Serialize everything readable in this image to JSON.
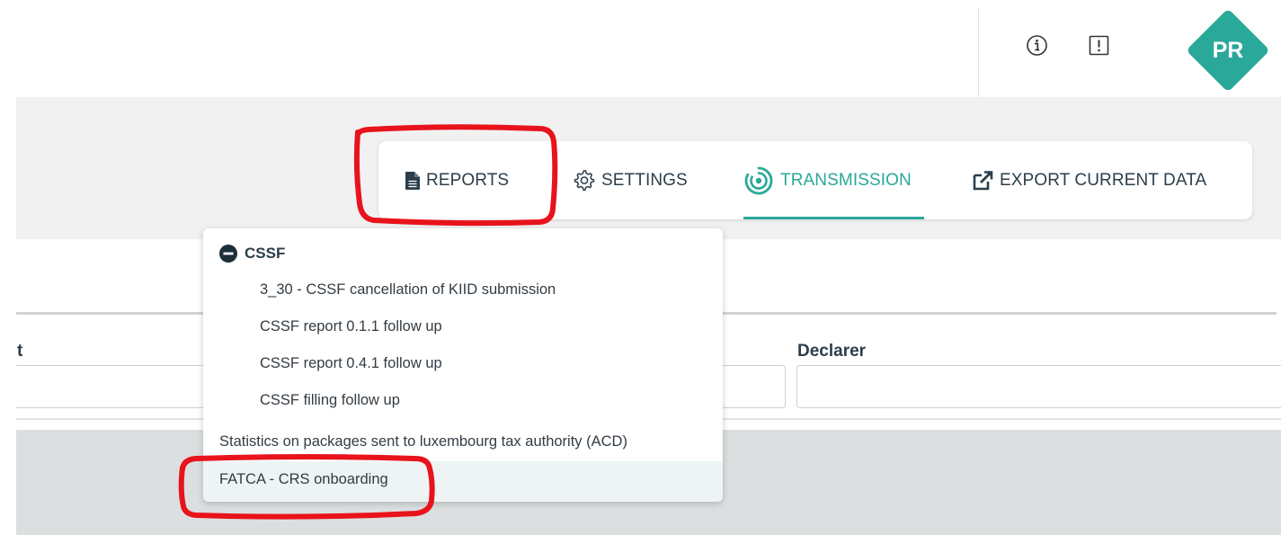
{
  "header": {
    "avatar_initials": "PR",
    "icons": [
      "info-icon",
      "alert-icon"
    ],
    "accent_color": "#2aa89a"
  },
  "toolbar": {
    "reports_label": "REPORTS",
    "settings_label": "SETTINGS",
    "transmission_label": "TRANSMISSION",
    "export_label": "EXPORT CURRENT DATA",
    "active_tab": "TRANSMISSION"
  },
  "filters": {
    "left_label_fragment": "t",
    "declarer_label": "Declarer",
    "left_value": "",
    "mid_value": "",
    "declarer_value": ""
  },
  "menu": {
    "group": {
      "label": "CSSF",
      "items": [
        "3_30 - CSSF cancellation of KIID submission",
        "CSSF report 0.1.1 follow up",
        "CSSF report 0.4.1 follow up",
        "CSSF filling follow up"
      ]
    },
    "items": [
      "Statistics on packages sent to luxembourg tax authority (ACD)",
      "FATCA - CRS onboarding"
    ],
    "highlighted_item": "FATCA - CRS onboarding"
  },
  "annotations": {
    "color": "#e8131b"
  }
}
